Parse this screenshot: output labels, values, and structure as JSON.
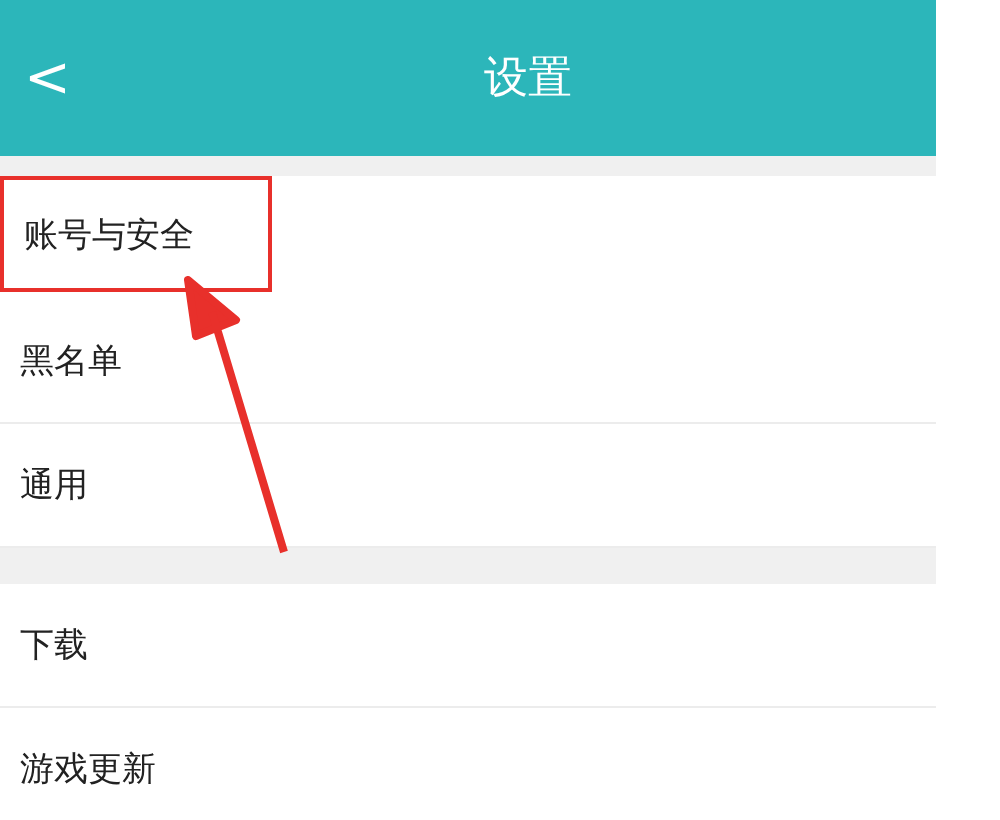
{
  "header": {
    "back": "<",
    "title": "设置"
  },
  "groups": [
    {
      "items": [
        {
          "label": "账号与安全",
          "highlighted": true
        },
        {
          "label": "黑名单",
          "highlighted": false
        },
        {
          "label": "通用",
          "highlighted": false
        }
      ]
    },
    {
      "items": [
        {
          "label": "下载",
          "highlighted": false
        },
        {
          "label": "游戏更新",
          "highlighted": false
        }
      ]
    }
  ]
}
